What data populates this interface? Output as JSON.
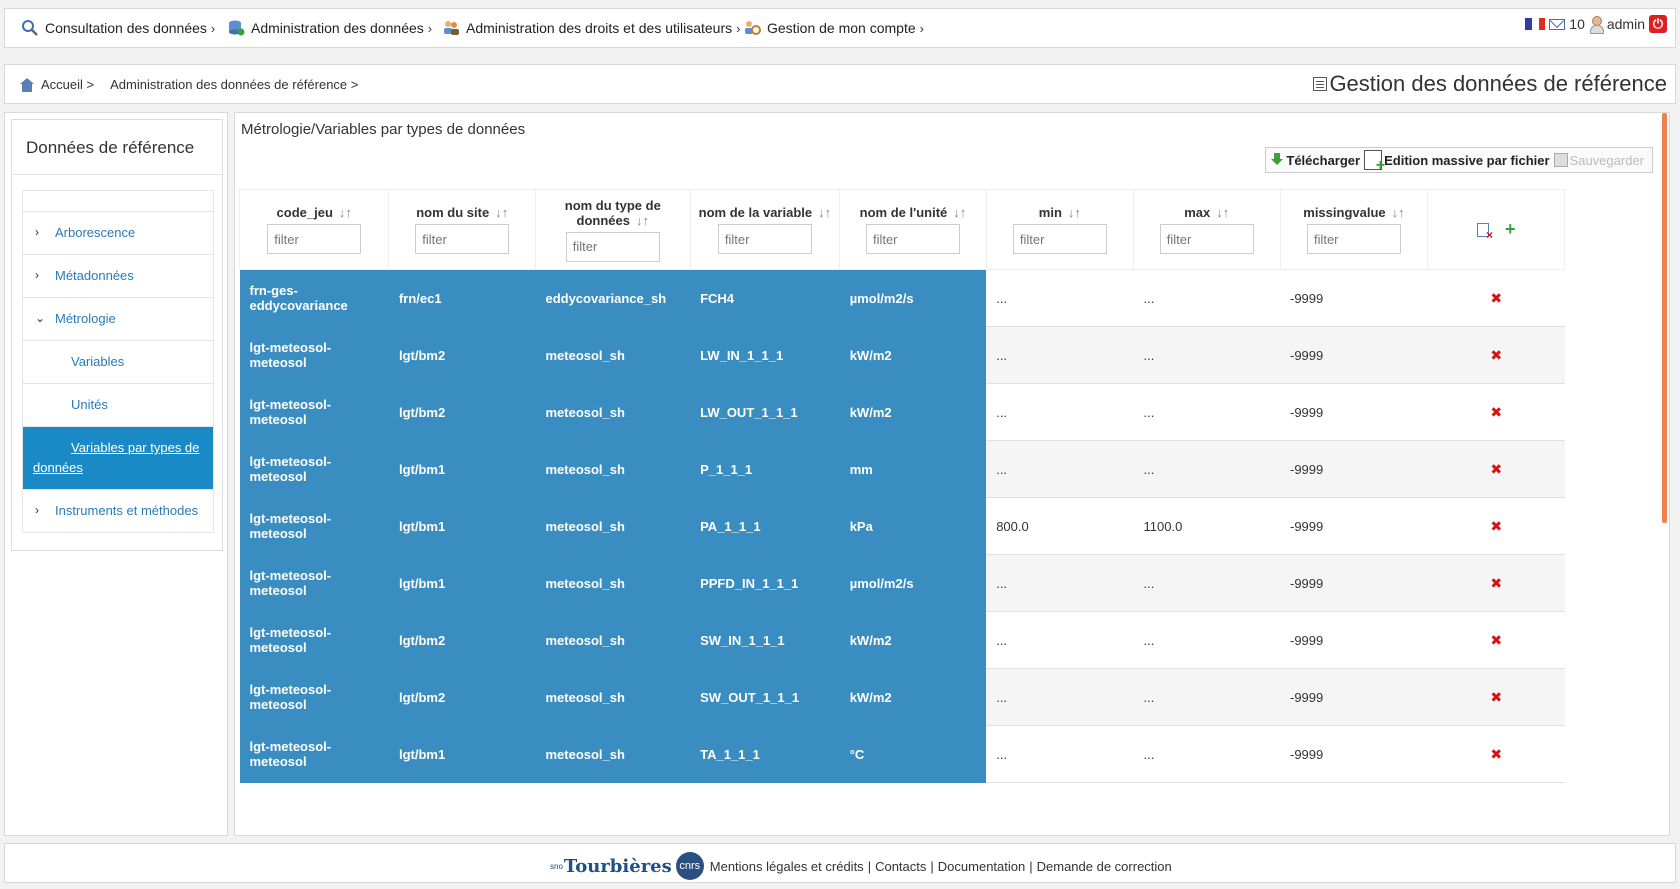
{
  "nav": {
    "items": [
      {
        "label": "Consultation des données",
        "icon": "search-icon"
      },
      {
        "label": "Administration des données",
        "icon": "database-admin-icon"
      },
      {
        "label": "Administration des droits et des utilisateurs",
        "icon": "users-rights-icon"
      },
      {
        "label": "Gestion de mon compte",
        "icon": "account-icon"
      }
    ],
    "message_count": "10",
    "username": "admin"
  },
  "breadcrumb": {
    "home": "Accueil >",
    "current": "Administration des données de référence >"
  },
  "page_title": "Gestion des données de référence",
  "sidebar": {
    "title": "Données de référence",
    "items": [
      {
        "label": "Arborescence",
        "arrow": ">"
      },
      {
        "label": "Métadonnées",
        "arrow": ">"
      },
      {
        "label": "Métrologie",
        "arrow": "v"
      },
      {
        "label": "Variables"
      },
      {
        "label": "Unités"
      },
      {
        "label": "Variables par types de données"
      },
      {
        "label": "Instruments et méthodes",
        "arrow": ">"
      }
    ]
  },
  "main": {
    "title": "Métrologie/Variables par types de données",
    "toolbar": {
      "download": "Télécharger",
      "bulk_edit": "Edition massive par fichier",
      "save": "Sauvegarder"
    },
    "filter_placeholder": "filter",
    "columns": [
      "code_jeu",
      "nom du site",
      "nom du type de données",
      "nom de la variable",
      "nom de l'unité",
      "min",
      "max",
      "missingvalue"
    ],
    "sort_glyph": "↓↑",
    "rows": [
      {
        "code_jeu": "frn-ges-eddycovariance",
        "site": "frn/ec1",
        "type": "eddycovariance_sh",
        "variable": "FCH4",
        "unit": "µmol/m2/s",
        "min": "...",
        "max": "...",
        "missing": "-9999"
      },
      {
        "code_jeu": "lgt-meteosol-meteosol",
        "site": "lgt/bm2",
        "type": "meteosol_sh",
        "variable": "LW_IN_1_1_1",
        "unit": "kW/m2",
        "min": "...",
        "max": "...",
        "missing": "-9999"
      },
      {
        "code_jeu": "lgt-meteosol-meteosol",
        "site": "lgt/bm2",
        "type": "meteosol_sh",
        "variable": "LW_OUT_1_1_1",
        "unit": "kW/m2",
        "min": "...",
        "max": "...",
        "missing": "-9999"
      },
      {
        "code_jeu": "lgt-meteosol-meteosol",
        "site": "lgt/bm1",
        "type": "meteosol_sh",
        "variable": "P_1_1_1",
        "unit": "mm",
        "min": "...",
        "max": "...",
        "missing": "-9999"
      },
      {
        "code_jeu": "lgt-meteosol-meteosol",
        "site": "lgt/bm1",
        "type": "meteosol_sh",
        "variable": "PA_1_1_1",
        "unit": "kPa",
        "min": "800.0",
        "max": "1100.0",
        "missing": "-9999"
      },
      {
        "code_jeu": "lgt-meteosol-meteosol",
        "site": "lgt/bm1",
        "type": "meteosol_sh",
        "variable": "PPFD_IN_1_1_1",
        "unit": "µmol/m2/s",
        "min": "...",
        "max": "...",
        "missing": "-9999"
      },
      {
        "code_jeu": "lgt-meteosol-meteosol",
        "site": "lgt/bm2",
        "type": "meteosol_sh",
        "variable": "SW_IN_1_1_1",
        "unit": "kW/m2",
        "min": "...",
        "max": "...",
        "missing": "-9999"
      },
      {
        "code_jeu": "lgt-meteosol-meteosol",
        "site": "lgt/bm2",
        "type": "meteosol_sh",
        "variable": "SW_OUT_1_1_1",
        "unit": "kW/m2",
        "min": "...",
        "max": "...",
        "missing": "-9999"
      },
      {
        "code_jeu": "lgt-meteosol-meteosol",
        "site": "lgt/bm1",
        "type": "meteosol_sh",
        "variable": "TA_1_1_1",
        "unit": "°C",
        "min": "...",
        "max": "...",
        "missing": "-9999"
      }
    ]
  },
  "footer": {
    "logo": "Tourbières",
    "logo_prefix": "sno",
    "cnrs": "cnrs",
    "links": [
      "Mentions légales et crédits",
      "Contacts",
      "Documentation",
      "Demande de correction"
    ]
  },
  "colors": {
    "highlight": "#3a8dc1",
    "active_tree": "#1a8ac7",
    "link": "#2a7ab8",
    "delete": "#d41414",
    "add": "#3aa03a"
  }
}
